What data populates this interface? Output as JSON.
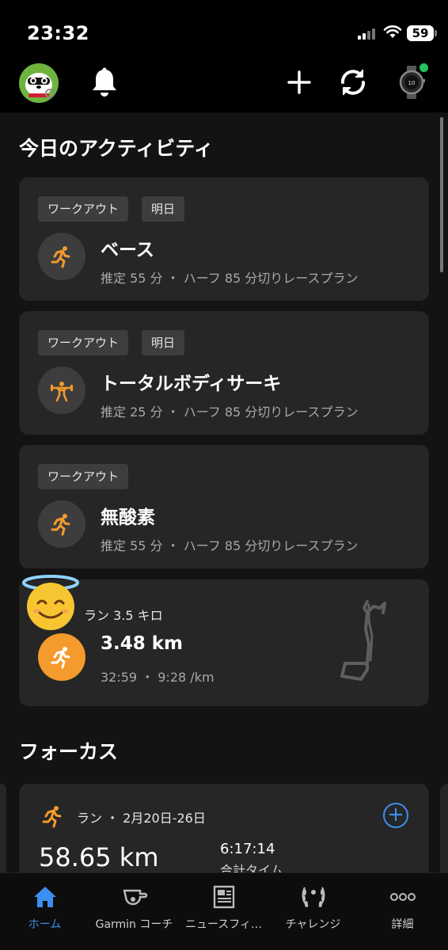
{
  "status": {
    "time": "23:32",
    "battery": "59"
  },
  "header": {
    "avatar": "avatar",
    "icons": [
      "bell-icon",
      "plus-icon",
      "sync-icon",
      "watch-icon"
    ],
    "colors": {
      "watch_status": "#22c55e"
    }
  },
  "today": {
    "title": "今日のアクティビティ",
    "cards": [
      {
        "tags": [
          "ワークアウト",
          "明日"
        ],
        "icon": "running-icon",
        "title": "ベース",
        "subtitle": "推定 55 分 ・ ハーフ 85 分切りレースプラン"
      },
      {
        "tags": [
          "ワークアウト",
          "明日"
        ],
        "icon": "strength-icon",
        "title": "トータルボディサーキ",
        "subtitle": "推定 25 分 ・ ハーフ 85 分切りレースプラン"
      },
      {
        "tags": [
          "ワークアウト"
        ],
        "icon": "running-icon",
        "title": "無酸素",
        "subtitle": "推定 55 分 ・ ハーフ 85 分切りレースプラン"
      }
    ],
    "run": {
      "label": "ラン 3.5 キロ",
      "distance": "3.48 km",
      "detail": "32:59 ・ 9:28 /km",
      "icon": "running-icon",
      "emoji": "halo-emoji",
      "color": "#f59a2c"
    }
  },
  "focus": {
    "title": "フォーカス",
    "card": {
      "header": "ラン ・ 2月20日-26日",
      "distance": "58.65 km",
      "time": "6:17:14",
      "time_label": "合計タイム",
      "accent": "#3b8ff0"
    }
  },
  "nav": {
    "items": [
      {
        "label": "ホーム",
        "icon": "home-icon",
        "active": true
      },
      {
        "label": "Garmin コーチ",
        "icon": "whistle-icon"
      },
      {
        "label": "ニュースフィ…",
        "icon": "newspaper-icon"
      },
      {
        "label": "チャレンジ",
        "icon": "laurel-icon"
      },
      {
        "label": "詳細",
        "icon": "more-icon"
      }
    ]
  }
}
